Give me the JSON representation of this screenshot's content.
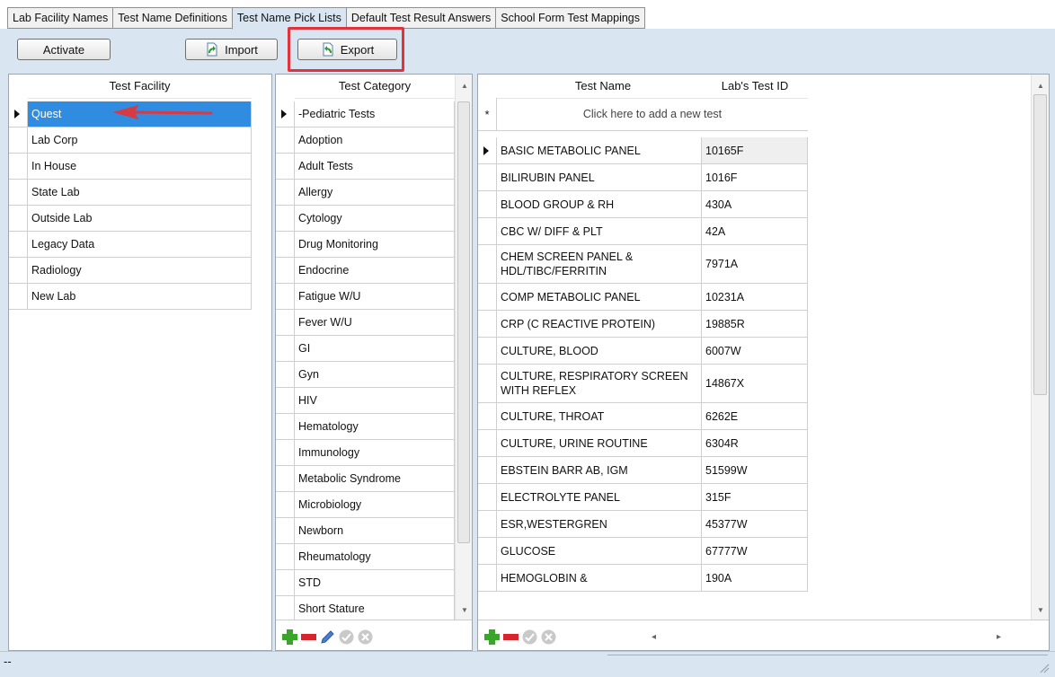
{
  "tabs": [
    {
      "label": "Lab Facility Names"
    },
    {
      "label": "Test Name Definitions"
    },
    {
      "label": "Test Name Pick Lists"
    },
    {
      "label": "Default Test Result Answers"
    },
    {
      "label": "School Form Test Mappings"
    }
  ],
  "toolbar": {
    "activate_label": "Activate",
    "import_label": "Import",
    "export_label": "Export"
  },
  "facility": {
    "header": "Test Facility",
    "items": [
      "Quest",
      "Lab Corp",
      "In House",
      "State Lab",
      "Outside Lab",
      "Legacy  Data",
      "Radiology",
      "New Lab"
    ],
    "selected_index": 0
  },
  "category": {
    "header": "Test Category",
    "items": [
      "-Pediatric Tests",
      "Adoption",
      "Adult Tests",
      "Allergy",
      "Cytology",
      "Drug Monitoring",
      "Endocrine",
      "Fatigue W/U",
      "Fever W/U",
      "GI",
      "Gyn",
      "HIV",
      "Hematology",
      "Immunology",
      "Metabolic Syndrome",
      "Microbiology",
      "Newborn",
      "Rheumatology",
      "STD",
      "Short Stature"
    ]
  },
  "tests": {
    "header_name": "Test Name",
    "header_id": "Lab's Test ID",
    "new_row_text": "Click here to add a new test",
    "new_row_marker": "*",
    "rows": [
      {
        "name": "BASIC METABOLIC PANEL",
        "id": "10165F"
      },
      {
        "name": "BILIRUBIN PANEL",
        "id": "1016F"
      },
      {
        "name": "BLOOD GROUP & RH",
        "id": "430A"
      },
      {
        "name": "CBC W/ DIFF  &  PLT",
        "id": "42A"
      },
      {
        "name": "CHEM SCREEN PANEL & HDL/TIBC/FERRITIN",
        "id": "7971A"
      },
      {
        "name": "COMP METABOLIC PANEL",
        "id": "10231A"
      },
      {
        "name": "CRP (C REACTIVE PROTEIN)",
        "id": "19885R"
      },
      {
        "name": "CULTURE, BLOOD",
        "id": "6007W"
      },
      {
        "name": "CULTURE, RESPIRATORY SCREEN WITH REFLEX",
        "id": "14867X"
      },
      {
        "name": "CULTURE, THROAT",
        "id": "6262E"
      },
      {
        "name": "CULTURE, URINE ROUTINE",
        "id": "6304R"
      },
      {
        "name": "EBSTEIN BARR AB, IGM",
        "id": "51599W"
      },
      {
        "name": "ELECTROLYTE PANEL",
        "id": "315F"
      },
      {
        "name": "ESR,WESTERGREN",
        "id": "45377W"
      },
      {
        "name": "GLUCOSE",
        "id": "67777W"
      },
      {
        "name": "HEMOGLOBIN &",
        "id": "190A"
      }
    ]
  },
  "status": {
    "text": "--"
  },
  "colors": {
    "selection": "#2f8ce0",
    "highlight": "#e0333b",
    "add": "#3aa52a",
    "remove": "#d8242c"
  }
}
